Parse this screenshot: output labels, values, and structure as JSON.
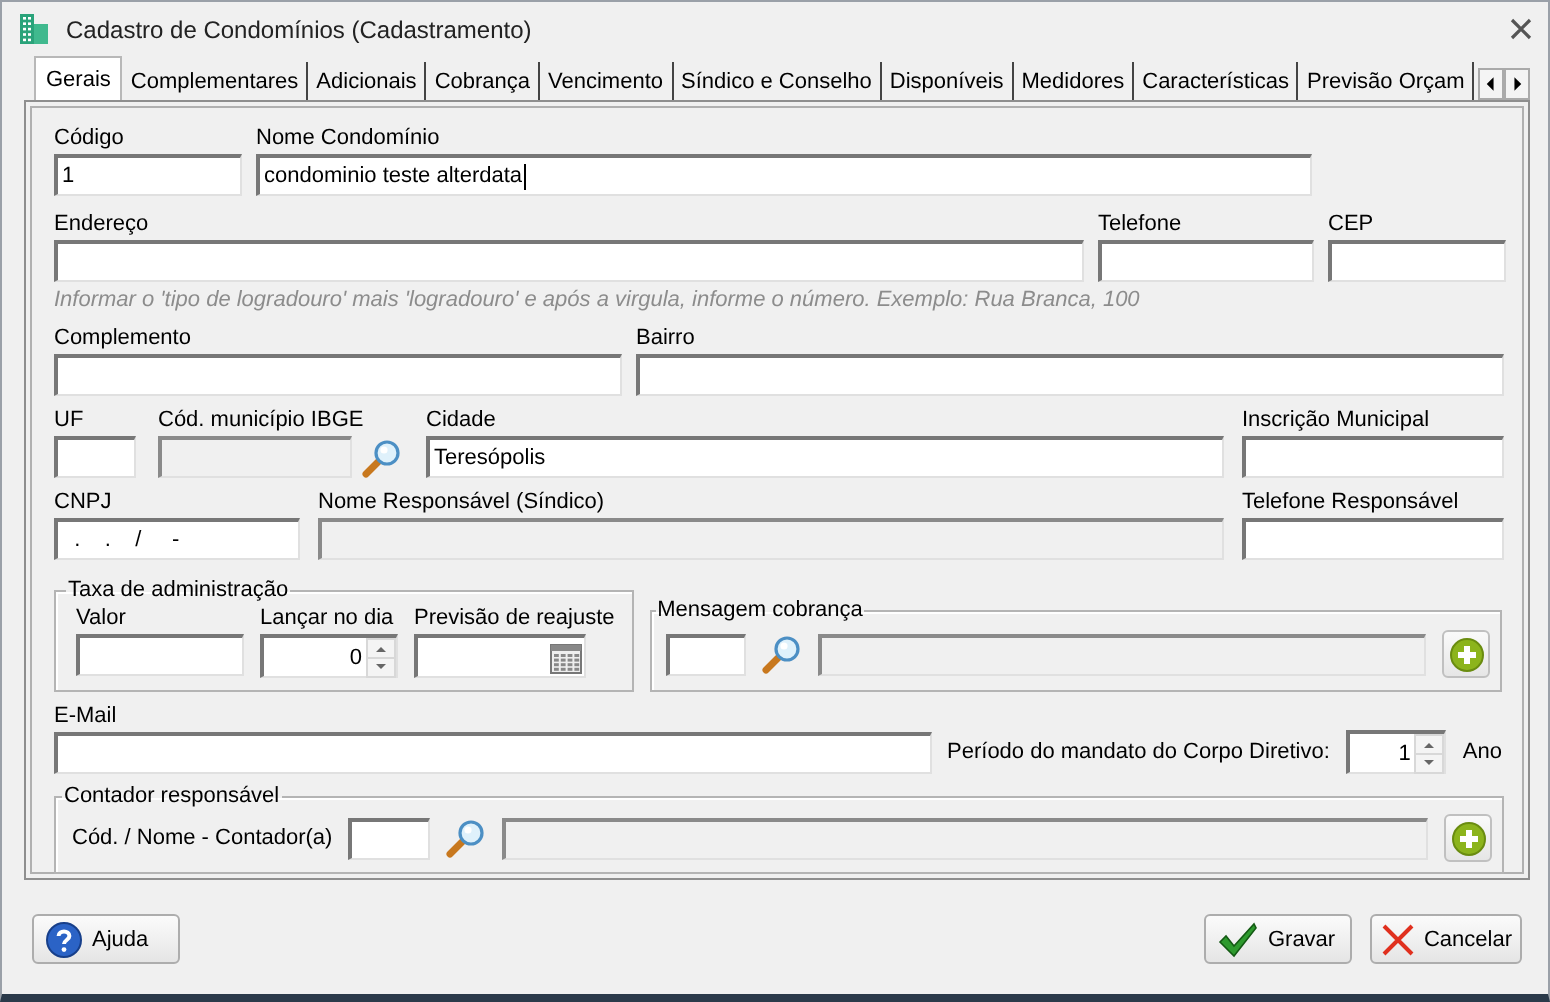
{
  "window": {
    "title": "Cadastro de Condomínios (Cadastramento)"
  },
  "tabs": [
    {
      "label": "Gerais",
      "selected": true
    },
    {
      "label": "Complementares",
      "selected": false
    },
    {
      "label": "Adicionais",
      "selected": false
    },
    {
      "label": "Cobrança",
      "selected": false
    },
    {
      "label": "Vencimento",
      "selected": false
    },
    {
      "label": "Síndico e Conselho",
      "selected": false
    },
    {
      "label": "Disponíveis",
      "selected": false
    },
    {
      "label": "Medidores",
      "selected": false
    },
    {
      "label": "Características",
      "selected": false
    },
    {
      "label": "Previsão Orçam",
      "selected": false
    }
  ],
  "form": {
    "codigo": {
      "label": "Código",
      "value": "1"
    },
    "nome_condominio": {
      "label": "Nome Condomínio",
      "value": "condominio teste alterdata",
      "focused": true
    },
    "endereco": {
      "label": "Endereço"
    },
    "telefone": {
      "label": "Telefone"
    },
    "cep": {
      "label": "CEP"
    },
    "endereco_hint": "Informar o 'tipo de logradouro' mais 'logradouro' e após a virgula, informe o número. Exemplo: Rua Branca, 100",
    "complemento": {
      "label": "Complemento"
    },
    "bairro": {
      "label": "Bairro"
    },
    "uf": {
      "label": "UF"
    },
    "cod_municipio_ibge": {
      "label": "Cód. município IBGE",
      "disabled": true
    },
    "cidade": {
      "label": "Cidade",
      "value": "Teresópolis"
    },
    "inscricao_municipal": {
      "label": "Inscrição Municipal"
    },
    "cnpj": {
      "label": "CNPJ",
      "value": "  .    .    /     -"
    },
    "nome_responsavel": {
      "label": "Nome Responsável (Síndico)",
      "disabled": true
    },
    "telefone_responsavel": {
      "label": "Telefone Responsável"
    },
    "taxa_administracao": {
      "title": "Taxa de administração",
      "valor": {
        "label": "Valor"
      },
      "lancar_no_dia": {
        "label": "Lançar no dia",
        "value": "0"
      },
      "previsao_reajuste": {
        "label": "Previsão de reajuste"
      }
    },
    "mensagem_cobranca": {
      "title": "Mensagem cobrança",
      "descricao": {
        "disabled": true
      }
    },
    "email": {
      "label": "E-Mail"
    },
    "periodo_mandato": {
      "label": "Período do mandato do Corpo Diretivo:",
      "value": "1",
      "unit": "Ano"
    },
    "contador": {
      "title": "Contador responsável",
      "label": "Cód. / Nome - Contador(a)",
      "nome": {
        "disabled": true
      }
    }
  },
  "buttons": [
    {
      "label": "Ajuda",
      "kind": "help"
    },
    {
      "label": "Gravar",
      "kind": "save"
    },
    {
      "label": "Cancelar",
      "kind": "cancel"
    }
  ]
}
